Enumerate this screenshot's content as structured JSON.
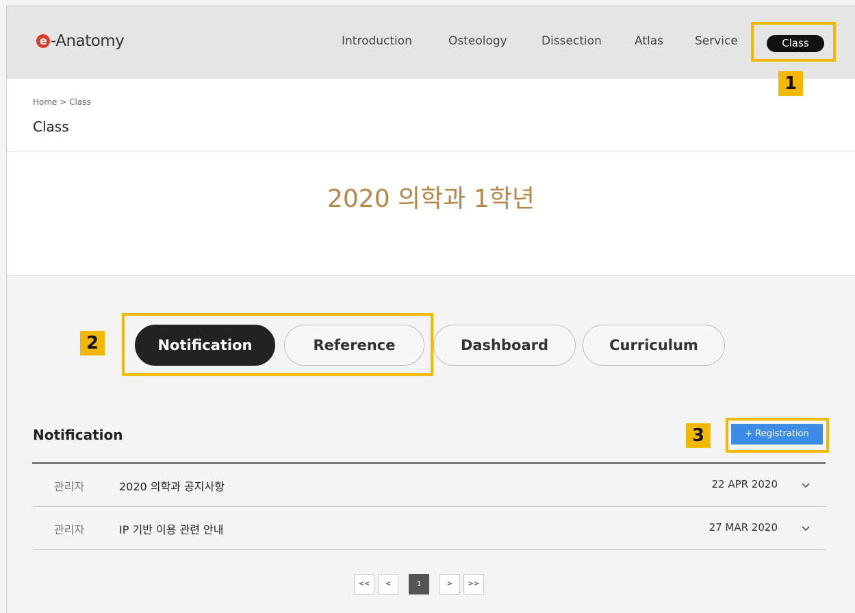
{
  "header": {
    "logo_mark": "e",
    "logo_text": "-Anatomy",
    "nav": [
      "Introduction",
      "Osteology",
      "Dissection",
      "Atlas",
      "Service"
    ],
    "nav_active": "Class"
  },
  "breadcrumb": {
    "home": "Home",
    "separator": ">",
    "current": "Class"
  },
  "page_title": "Class",
  "banner_title": "2020 의학과 1학년",
  "tabs": [
    "Notification",
    "Reference",
    "Dashboard",
    "Curriculum"
  ],
  "active_tab": "Notification",
  "section": {
    "title": "Notification",
    "register_label": "+ Registration"
  },
  "notices": [
    {
      "author": "관리자",
      "subject": "2020 의학과 공지사항",
      "date": "22 APR 2020"
    },
    {
      "author": "관리자",
      "subject": "IP 기반 이용 관련 안내",
      "date": "27 MAR 2020"
    }
  ],
  "pagination": {
    "first": "<<",
    "prev": "<",
    "current": "1",
    "next": ">",
    "last": ">>"
  },
  "annotations": [
    "1",
    "2",
    "3"
  ],
  "colors": {
    "accent": "#f4b800",
    "title": "#b98548",
    "button": "#3d8de8",
    "logo": "#d93a2b"
  }
}
